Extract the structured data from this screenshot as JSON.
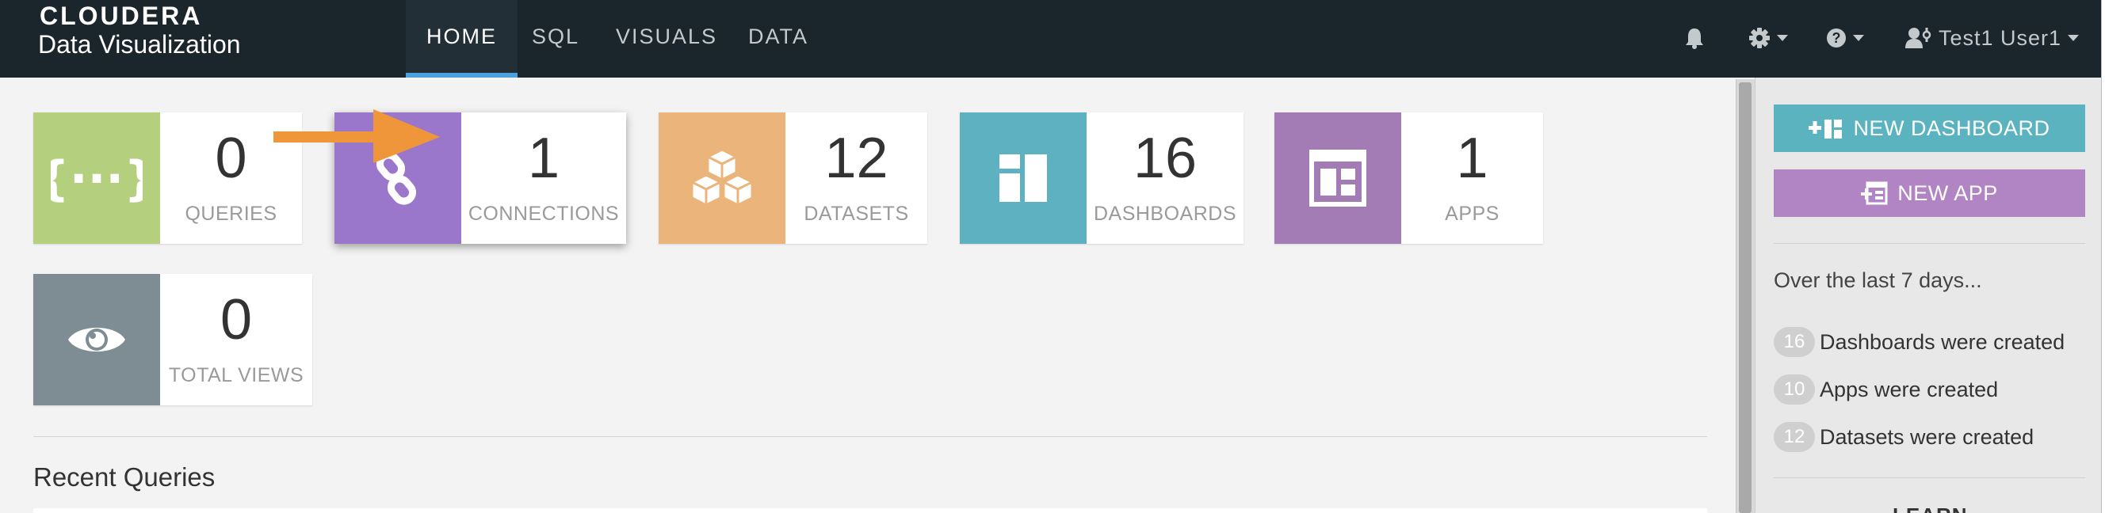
{
  "brand": {
    "line1": "CLOUDERA",
    "line2": "Data Visualization"
  },
  "nav": {
    "tabs": [
      {
        "label": "HOME",
        "active": true
      },
      {
        "label": "SQL"
      },
      {
        "label": "VISUALS"
      },
      {
        "label": "DATA"
      }
    ],
    "icons": [
      "bell-icon",
      "gear-icon",
      "help-icon",
      "user-icon"
    ],
    "user": "Test1 User1"
  },
  "cards": [
    {
      "count": "0",
      "label": "QUERIES",
      "color": "#b4cf7e",
      "icon": "braces-icon"
    },
    {
      "count": "1",
      "label": "CONNECTIONS",
      "color": "#9b77cc",
      "icon": "link-icon"
    },
    {
      "count": "12",
      "label": "DATASETS",
      "color": "#ebb47b",
      "icon": "cubes-icon"
    },
    {
      "count": "16",
      "label": "DASHBOARDS",
      "color": "#5db1c0",
      "icon": "dashboard-icon"
    },
    {
      "count": "1",
      "label": "APPS",
      "color": "#a37cb5",
      "icon": "app-icon"
    },
    {
      "count": "0",
      "label": "TOTAL VIEWS",
      "color": "#7e8c94",
      "icon": "eye-icon"
    }
  ],
  "recent": {
    "title": "Recent Queries"
  },
  "sidebar": {
    "new_dashboard": "NEW DASHBOARD",
    "new_app": "NEW APP",
    "period": "Over the last 7 days...",
    "activity": [
      {
        "count": "16",
        "text": "Dashboards were created"
      },
      {
        "count": "10",
        "text": "Apps were created"
      },
      {
        "count": "12",
        "text": "Datasets were created"
      }
    ],
    "learn": "LEARN"
  },
  "colors": {
    "navbar": "#1b262c",
    "accent": "#4ba1db",
    "arrow": "#f0963a"
  }
}
